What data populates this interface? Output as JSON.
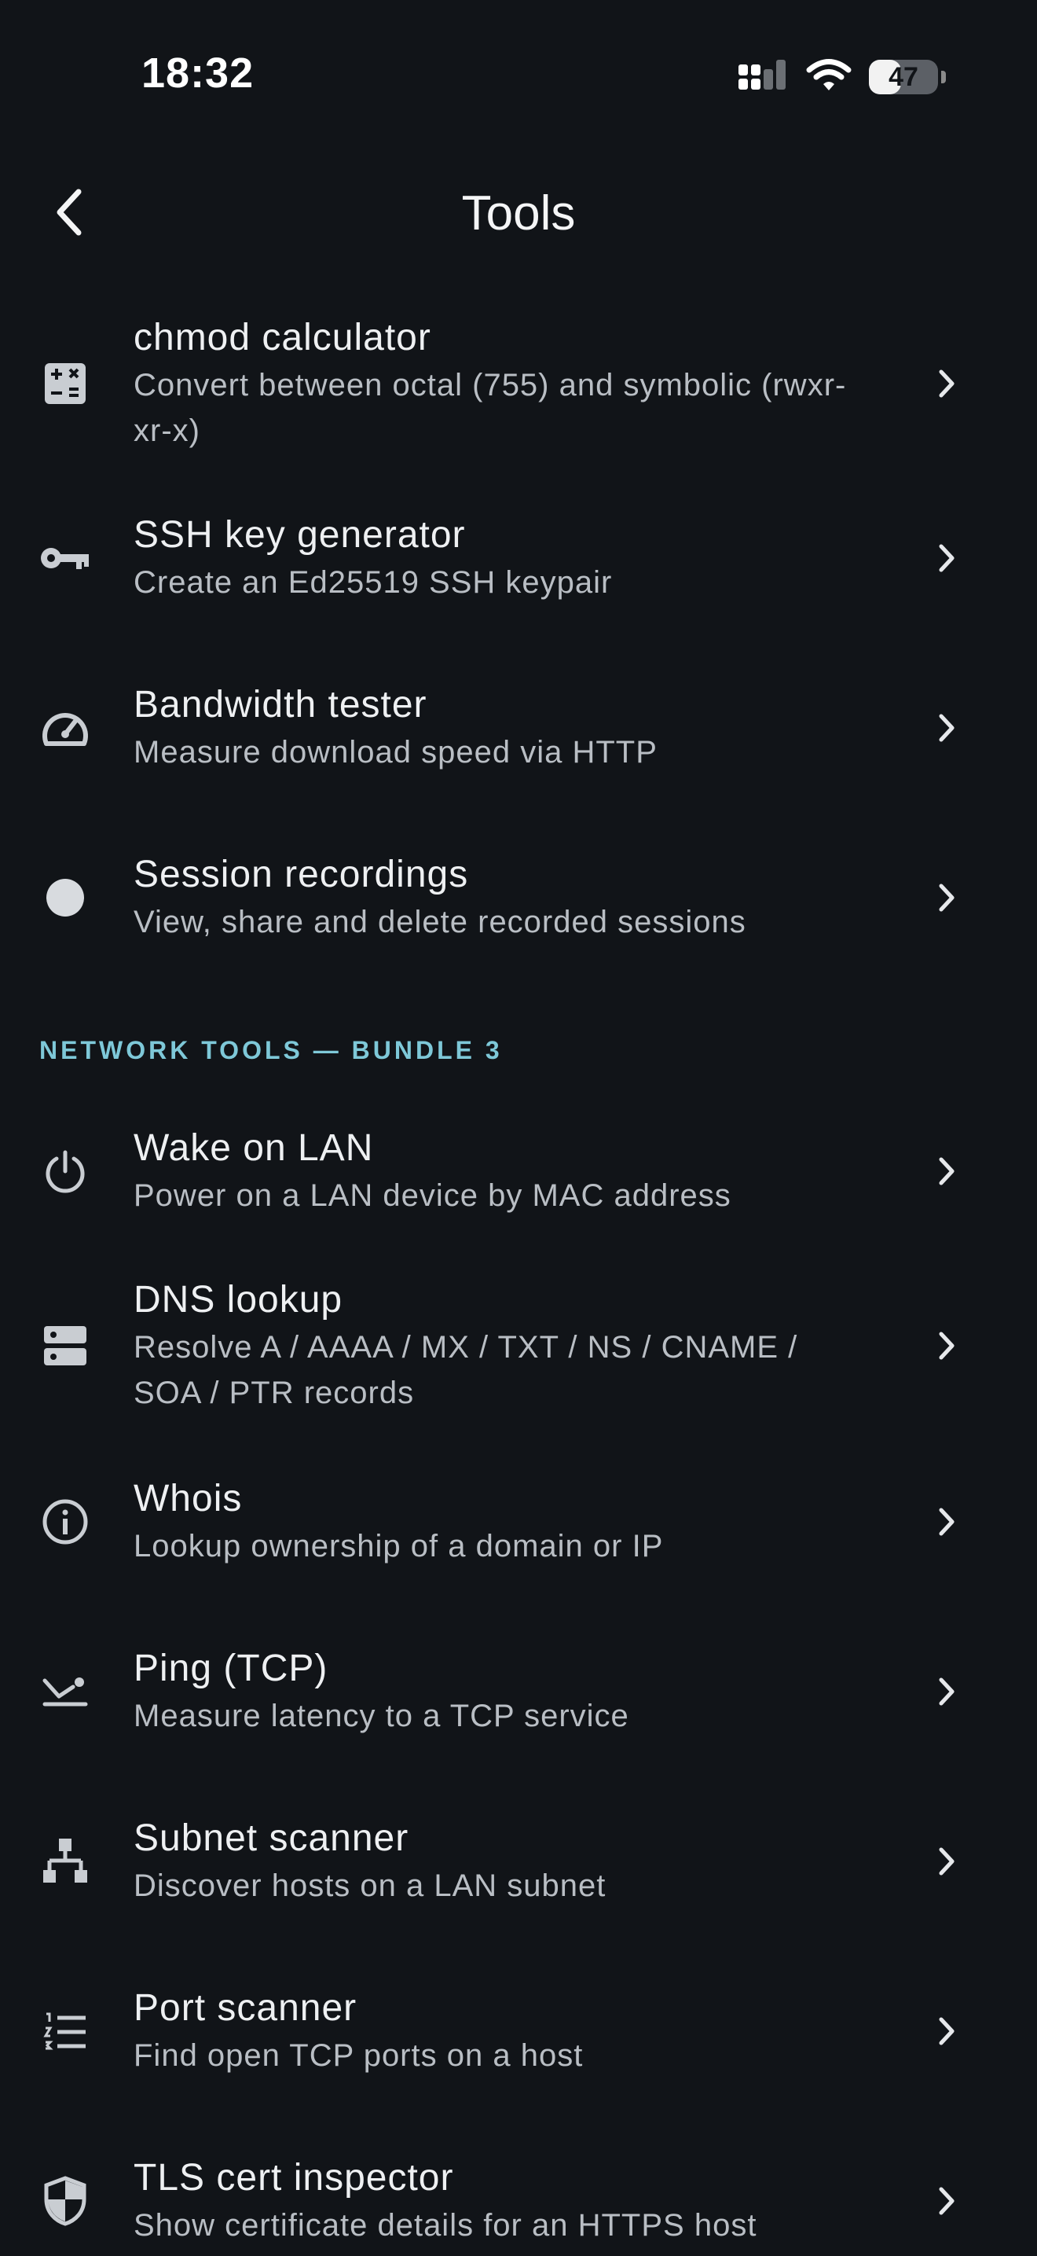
{
  "status": {
    "time": "18:32",
    "battery": "47",
    "battery_level": 0.47
  },
  "header": {
    "title": "Tools"
  },
  "section": {
    "network_tools": "NETWORK TOOLS — BUNDLE 3"
  },
  "tools": [
    {
      "label": "chmod calculator",
      "sub": "Convert between octal (755) and symbolic (rwxr-xr-x)",
      "icon": "calculator-icon"
    },
    {
      "label": "SSH key generator",
      "sub": "Create an Ed25519 SSH keypair",
      "icon": "key-icon"
    },
    {
      "label": "Bandwidth tester",
      "sub": "Measure download speed via HTTP",
      "icon": "speedometer-icon"
    },
    {
      "label": "Session recordings",
      "sub": "View, share and delete recorded sessions",
      "icon": "record-icon"
    }
  ],
  "network_tools": [
    {
      "label": "Wake on LAN",
      "sub": "Power on a LAN device by MAC address",
      "icon": "power-icon"
    },
    {
      "label": "DNS lookup",
      "sub": "Resolve A / AAAA / MX / TXT / NS / CNAME / SOA / PTR records",
      "icon": "dns-icon"
    },
    {
      "label": "Whois",
      "sub": "Lookup ownership of a domain or IP",
      "icon": "info-icon"
    },
    {
      "label": "Ping (TCP)",
      "sub": "Measure latency to a TCP service",
      "icon": "ping-icon"
    },
    {
      "label": "Subnet scanner",
      "sub": "Discover hosts on a LAN subnet",
      "icon": "network-tree-icon"
    },
    {
      "label": "Port scanner",
      "sub": "Find open TCP ports on a host",
      "icon": "numbered-list-icon"
    },
    {
      "label": "TLS cert inspector",
      "sub": "Show certificate details for an HTTPS host",
      "icon": "shield-icon"
    }
  ]
}
